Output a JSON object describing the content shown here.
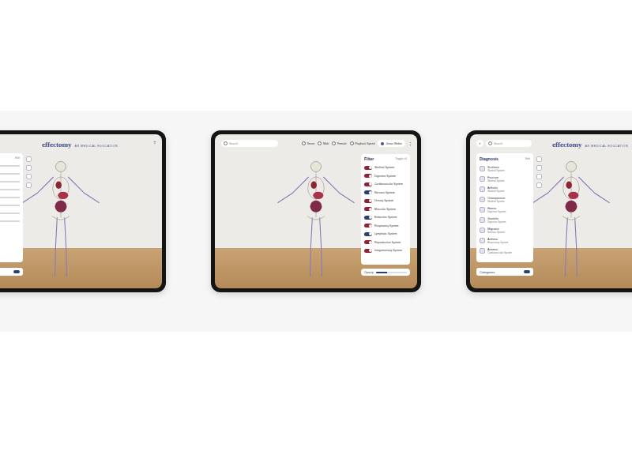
{
  "brand": {
    "name": "effectomy",
    "tagline": "AR MEDICAL EDUCATION"
  },
  "left_tablet": {
    "help": "?",
    "panel": {
      "action": "Edit"
    }
  },
  "center_tablet": {
    "search": {
      "placeholder": "Search"
    },
    "toolbar": [
      "Sexes",
      "Male",
      "Female",
      "Playback Speed"
    ],
    "user": "Jonas Weber",
    "menu": "⋮",
    "filters": {
      "title": "Filter",
      "action": "Toggle all",
      "systems": [
        {
          "name": "Skeletal System",
          "on": true,
          "color": "#8e2434"
        },
        {
          "name": "Digestive System",
          "on": true,
          "color": "#8e2434"
        },
        {
          "name": "Cardiovascular System",
          "on": true,
          "color": "#8e2434"
        },
        {
          "name": "Nervous System",
          "on": true,
          "color": "#2c3e72"
        },
        {
          "name": "Urinary System",
          "on": true,
          "color": "#8e2434"
        },
        {
          "name": "Muscular System",
          "on": true,
          "color": "#8e2434"
        },
        {
          "name": "Endocrine System",
          "on": true,
          "color": "#2c3e72"
        },
        {
          "name": "Respiratory System",
          "on": true,
          "color": "#8e2434"
        },
        {
          "name": "Lymphatic System",
          "on": true,
          "color": "#2c3e72"
        },
        {
          "name": "Reproductive System",
          "on": true,
          "color": "#8e2434"
        },
        {
          "name": "Integumentary System",
          "on": true,
          "color": "#8e2434"
        }
      ]
    },
    "opacity": {
      "label": "Opacity",
      "level": 0.35
    }
  },
  "right_tablet": {
    "back": "‹",
    "search": {
      "placeholder": "Search"
    },
    "help": "?",
    "panel": {
      "title": "Diagnosis",
      "action": "Edit",
      "items": [
        {
          "name": "Scoliosis",
          "category": "Skeletal System"
        },
        {
          "name": "Fracture",
          "category": "Skeletal System"
        },
        {
          "name": "Arthritis",
          "category": "Skeletal System"
        },
        {
          "name": "Osteoporosis",
          "category": "Skeletal System"
        },
        {
          "name": "Hernia",
          "category": "Digestive System"
        },
        {
          "name": "Gastritis",
          "category": "Digestive System"
        },
        {
          "name": "Migraine",
          "category": "Nervous System"
        },
        {
          "name": "Asthma",
          "category": "Respiratory System"
        },
        {
          "name": "Anemia",
          "category": "Cardiovascular System"
        }
      ]
    },
    "footer": {
      "label": "Categories"
    }
  }
}
